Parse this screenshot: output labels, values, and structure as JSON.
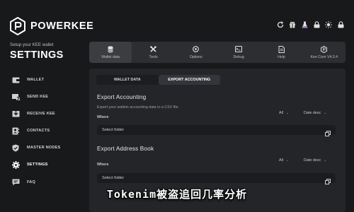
{
  "brand": {
    "name": "POWERKEE"
  },
  "sidebar": {
    "setup_line": "Setup your KEE wallet",
    "heading": "SETTINGS",
    "items": [
      {
        "label": "WALLET",
        "icon": "wallet-icon"
      },
      {
        "label": "SEND KEE",
        "icon": "send-icon"
      },
      {
        "label": "RECEIVE KEE",
        "icon": "receive-icon"
      },
      {
        "label": "CONTACTS",
        "icon": "contacts-icon"
      },
      {
        "label": "MASTER NODES",
        "icon": "shield-icon"
      },
      {
        "label": "SETTINGS",
        "icon": "gear-icon",
        "active": true
      },
      {
        "label": "FAQ",
        "icon": "chat-icon"
      }
    ]
  },
  "status_icons": [
    "refresh-icon",
    "gift-icon",
    "flask-icon",
    "lock-icon",
    "sun-icon",
    "lock-icon"
  ],
  "toolbar": {
    "items": [
      {
        "label": "Wallet data",
        "icon": "database-icon",
        "active": true
      },
      {
        "label": "Tools",
        "icon": "tools-icon"
      },
      {
        "label": "Options",
        "icon": "options-icon"
      },
      {
        "label": "Debug",
        "icon": "debug-icon"
      },
      {
        "label": "Help",
        "icon": "help-icon"
      },
      {
        "label": "Kee Core V4.3.4",
        "icon": "core-icon"
      }
    ]
  },
  "tabs": [
    {
      "label": "WALLET DATA",
      "active": false
    },
    {
      "label": "EXPORT ACCOUNTING",
      "active": true
    }
  ],
  "export_accounting": {
    "title": "Export Accounting",
    "description": "Export your wallets accounting data to a CSV file.",
    "where_label": "Where",
    "filter_value": "All",
    "sort_value": "Date desc",
    "folder_placeholder": "Select folder"
  },
  "export_address_book": {
    "title": "Export Address Book",
    "where_label": "Where",
    "filter_value": "All",
    "sort_value": "Date desc",
    "folder_placeholder": "Select folder"
  },
  "caption": "Tokenim被盗追回几率分析",
  "colors": {
    "background": "#18191b",
    "panel": "#242528",
    "toolbar": "#2d2e31",
    "field": "#1b1c1f",
    "text": "#ffffff"
  }
}
